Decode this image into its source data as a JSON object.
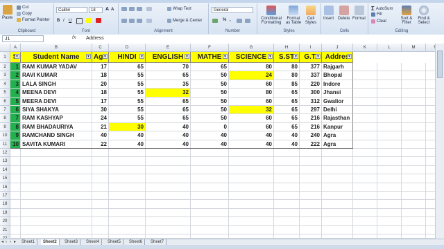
{
  "ribbon": {
    "clipboard": {
      "paste": "Paste",
      "cut": "Cut",
      "copy": "Copy",
      "format_painter": "Format Painter",
      "label": "Clipboard"
    },
    "font": {
      "name": "Calibri",
      "size": "18",
      "label": "Font"
    },
    "alignment": {
      "wrap_text": "Wrap Text",
      "merge_center": "Merge & Center",
      "label": "Alignment"
    },
    "number": {
      "format": "General",
      "percent": "%",
      "comma": ",",
      "label": "Number"
    },
    "styles": {
      "conditional": "Conditional Formatting",
      "format_table": "Format as Table",
      "cell_styles": "Cell Styles",
      "label": "Styles"
    },
    "cells": {
      "insert": "Insert",
      "delete": "Delete",
      "format": "Format",
      "label": "Cells"
    },
    "editing": {
      "autosum": "AutoSum",
      "fill": "Fill",
      "clear": "Clear",
      "sort": "Sort & Filter",
      "find": "Find & Select",
      "label": "Editing"
    }
  },
  "formula_bar": {
    "name_box": "J1",
    "fx": "fx",
    "value": "Address"
  },
  "columns": [
    "A",
    "B",
    "C",
    "D",
    "E",
    "F",
    "G",
    "H",
    "I",
    "J",
    "K",
    "L",
    "M",
    "N"
  ],
  "headers": [
    "S",
    "Student Name",
    "Age",
    "HINDI",
    "ENGLISH",
    "MATHE",
    "SCIENCE",
    "S.ST",
    "G.T.",
    "Addres"
  ],
  "rows": [
    {
      "sno": "1",
      "name": "RAM KUMAR YADAV",
      "age": "17",
      "hindi": "65",
      "english": "70",
      "math": "65",
      "science": "80",
      "sst": "80",
      "gt": "377",
      "addr": "Rajgarh"
    },
    {
      "sno": "2",
      "name": "RAVI KUMAR",
      "age": "18",
      "hindi": "55",
      "english": "65",
      "math": "50",
      "science": "24",
      "sst": "80",
      "gt": "337",
      "addr": "Bhopal"
    },
    {
      "sno": "3",
      "name": "LALA SINGH",
      "age": "20",
      "hindi": "55",
      "english": "35",
      "math": "50",
      "science": "60",
      "sst": "85",
      "gt": "220",
      "addr": "Indore"
    },
    {
      "sno": "4",
      "name": "MEENA DEVI",
      "age": "18",
      "hindi": "55",
      "english": "32",
      "math": "50",
      "science": "80",
      "sst": "65",
      "gt": "300",
      "addr": "Jhansi"
    },
    {
      "sno": "5",
      "name": "MEERA DEVI",
      "age": "17",
      "hindi": "55",
      "english": "65",
      "math": "50",
      "science": "60",
      "sst": "65",
      "gt": "312",
      "addr": "Gwalior"
    },
    {
      "sno": "6",
      "name": "SIYA SHAKYA",
      "age": "30",
      "hindi": "55",
      "english": "65",
      "math": "50",
      "science": "32",
      "sst": "65",
      "gt": "297",
      "addr": "Delhi"
    },
    {
      "sno": "7",
      "name": "RAM KASHYAP",
      "age": "24",
      "hindi": "55",
      "english": "65",
      "math": "50",
      "science": "60",
      "sst": "65",
      "gt": "216",
      "addr": "Rajasthan"
    },
    {
      "sno": "8",
      "name": "RAM BHADAURIYA",
      "age": "21",
      "hindi": "30",
      "english": "40",
      "math": "0",
      "science": "60",
      "sst": "65",
      "gt": "216",
      "addr": "Kanpur"
    },
    {
      "sno": "9",
      "name": "RAMCHAND SINGH",
      "age": "40",
      "hindi": "40",
      "english": "40",
      "math": "40",
      "science": "40",
      "sst": "40",
      "gt": "240",
      "addr": "Agra"
    },
    {
      "sno": "10",
      "name": "SAVITA KUMARI",
      "age": "22",
      "hindi": "40",
      "english": "40",
      "math": "40",
      "science": "40",
      "sst": "40",
      "gt": "222",
      "addr": "Agra"
    }
  ],
  "extra_rows": [
    "11",
    "12",
    "13",
    "14",
    "15",
    "16",
    "17",
    "18",
    "19",
    "20",
    "21",
    "22"
  ],
  "sheets": [
    "Sheet1",
    "Sheet2",
    "Sheet3",
    "Sheet4",
    "Sheet5",
    "Sheet6",
    "Sheet7"
  ],
  "active_sheet": "Sheet2",
  "colors": {
    "header_fill": "#ffff00",
    "sno_fill": "#22b14c",
    "highlight": "#ffff00"
  }
}
